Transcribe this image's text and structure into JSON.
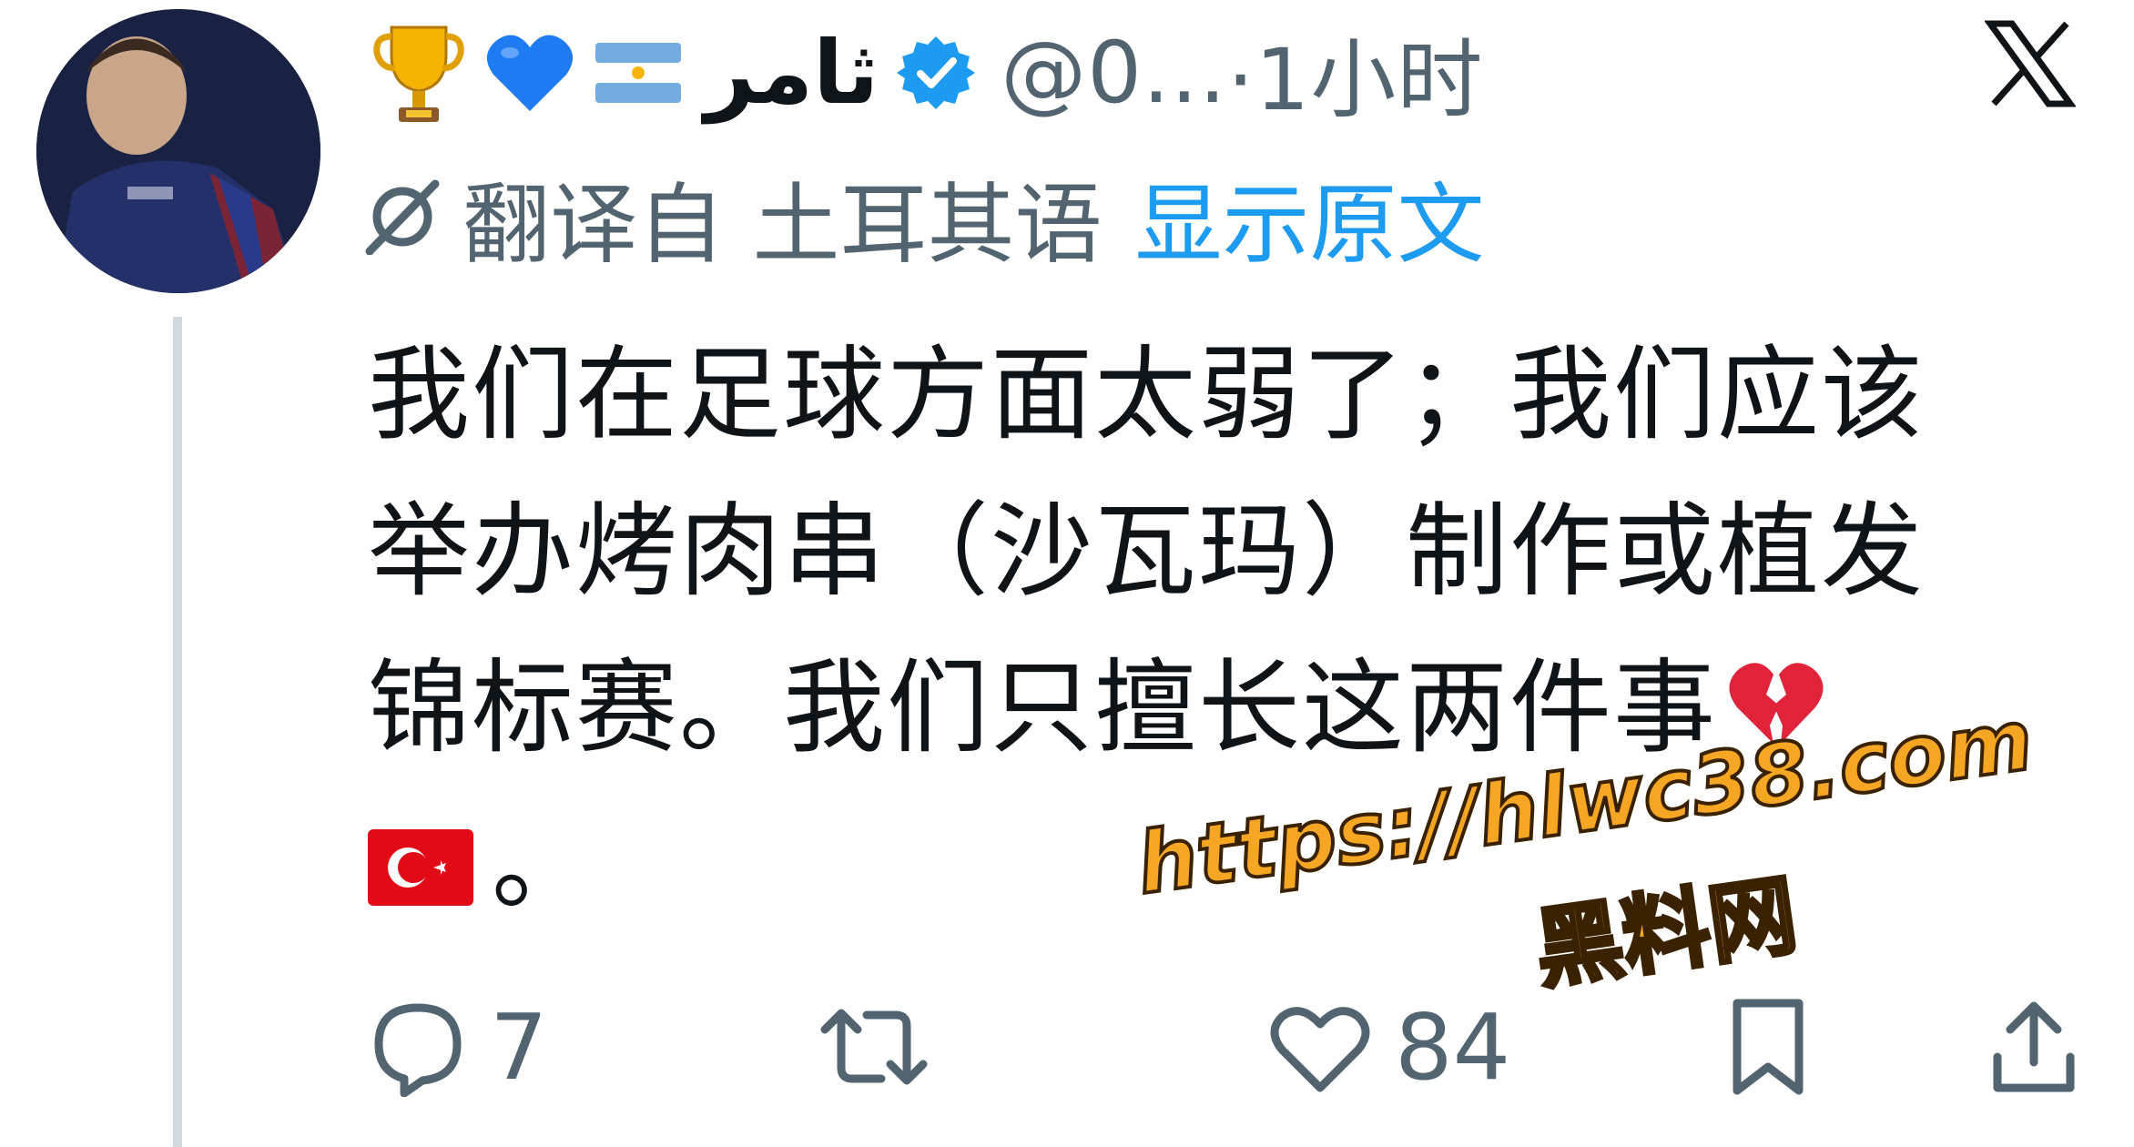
{
  "tweet": {
    "author": {
      "name": "ثامر",
      "handle": "@0...",
      "time": "·1小时",
      "verified": true,
      "name_emojis": [
        "trophy-icon",
        "blue-heart-icon",
        "argentina-flag-icon"
      ]
    },
    "translation": {
      "translated_from": "翻译自 土耳其语",
      "show_original": "显示原文"
    },
    "text_lines": [
      "我们在足球方面太弱了；我们应该",
      "举办烤肉串（沙瓦玛）制作或植发",
      "锦标赛。我们只擅长这两件事",
      "。"
    ],
    "text_emojis": [
      "broken-heart-icon",
      "turkey-flag-icon"
    ],
    "actions": {
      "reply_count": "7",
      "retweet_count": "",
      "like_count": "84",
      "bookmark_count": ""
    }
  },
  "watermark": {
    "url": "https://hlwc38.com",
    "site": "黑料网"
  },
  "colors": {
    "text_primary": "#0f1419",
    "text_secondary": "#536471",
    "link_blue": "#1d9bf0",
    "verified_blue": "#1d9bf0",
    "thread_line": "#cfd9de",
    "watermark_orange": "#f5a623"
  }
}
